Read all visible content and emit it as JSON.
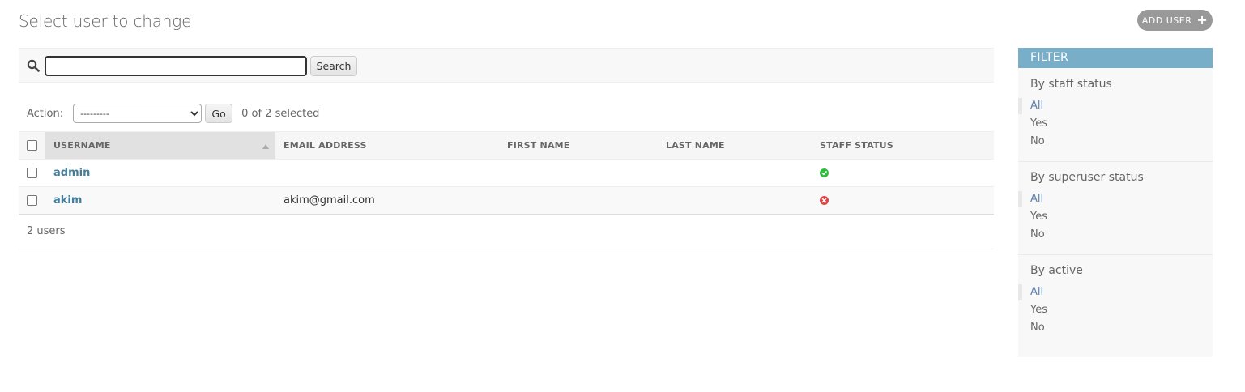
{
  "page": {
    "title": "Select user to change",
    "add_button": "ADD USER",
    "add_icon": "+"
  },
  "search": {
    "value": "",
    "button": "Search"
  },
  "actions": {
    "label": "Action:",
    "selected_option": "---------",
    "go_button": "Go",
    "selection_count": "0 of 2 selected"
  },
  "table": {
    "columns": [
      "USERNAME",
      "EMAIL ADDRESS",
      "FIRST NAME",
      "LAST NAME",
      "STAFF STATUS"
    ],
    "rows": [
      {
        "username": "admin",
        "email": "",
        "first_name": "",
        "last_name": "",
        "staff_status": "yes"
      },
      {
        "username": "akim",
        "email": "akim@gmail.com",
        "first_name": "",
        "last_name": "",
        "staff_status": "no"
      }
    ]
  },
  "paginator": {
    "text": "2 users"
  },
  "filter": {
    "header": "FILTER",
    "groups": [
      {
        "title": "By staff status",
        "options": [
          "All",
          "Yes",
          "No"
        ],
        "selected": "All"
      },
      {
        "title": "By superuser status",
        "options": [
          "All",
          "Yes",
          "No"
        ],
        "selected": "All"
      },
      {
        "title": "By active",
        "options": [
          "All",
          "Yes",
          "No"
        ],
        "selected": "All"
      }
    ]
  },
  "colors": {
    "filter_header": "#79aec8",
    "link": "#447e9b",
    "status_yes": "#2ebd3c",
    "status_no": "#dd4646"
  }
}
